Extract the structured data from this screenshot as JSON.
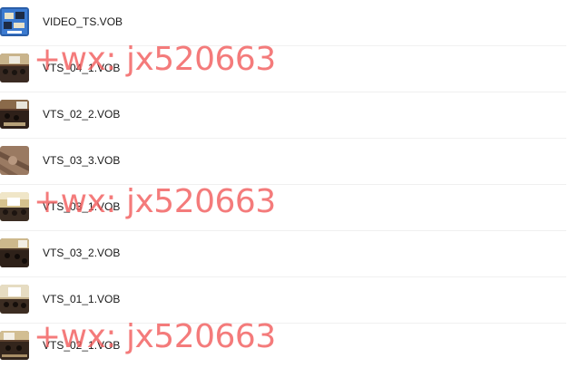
{
  "files": [
    {
      "name": "VIDEO_TS.VOB",
      "thumbnail": "dvd-folder-icon"
    },
    {
      "name": "VTS_04_1.VOB",
      "thumbnail": "video-thumbnail"
    },
    {
      "name": "VTS_02_2.VOB",
      "thumbnail": "video-thumbnail"
    },
    {
      "name": "VTS_03_3.VOB",
      "thumbnail": "video-thumbnail"
    },
    {
      "name": "VTS_03_1.VOB",
      "thumbnail": "video-thumbnail"
    },
    {
      "name": "VTS_03_2.VOB",
      "thumbnail": "video-thumbnail"
    },
    {
      "name": "VTS_01_1.VOB",
      "thumbnail": "video-thumbnail"
    },
    {
      "name": "VTS_02_1.VOB",
      "thumbnail": "video-thumbnail"
    }
  ],
  "watermark": {
    "text": "+wx: jx520663",
    "color": "#f15a5a"
  },
  "colors": {
    "text": "#1a1a1a",
    "row_divider": "#f0f0f0"
  }
}
